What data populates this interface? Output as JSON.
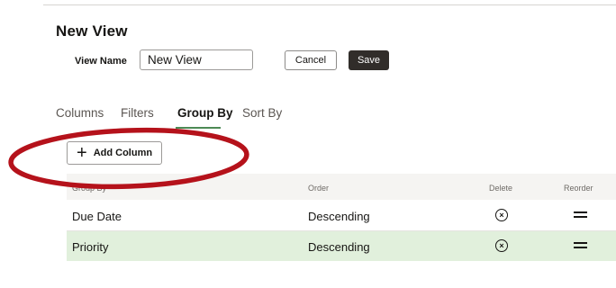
{
  "header": {
    "title": "New View"
  },
  "view_name": {
    "label": "View Name",
    "value": "New View"
  },
  "buttons": {
    "cancel": "Cancel",
    "save": "Save",
    "add_column": "Add Column"
  },
  "tabs": [
    {
      "label": "Columns",
      "active": false
    },
    {
      "label": "Filters",
      "active": false
    },
    {
      "label": "Group By",
      "active": true
    },
    {
      "label": "Sort By",
      "active": false
    }
  ],
  "table": {
    "headers": {
      "group_by": "Group By",
      "order": "Order",
      "delete": "Delete",
      "reorder": "Reorder"
    },
    "rows": [
      {
        "column": "Due Date",
        "order": "Descending",
        "selected": false
      },
      {
        "column": "Priority",
        "order": "Descending",
        "selected": true
      }
    ]
  },
  "icons": {
    "add": "plus-icon",
    "delete": "close-circle-icon",
    "reorder": "drag-handle-icon"
  },
  "colors": {
    "accent": "#4d8a55",
    "selected_row": "#e1f0dc",
    "annotation": "#b5121b",
    "primary_button": "#312d2a"
  }
}
